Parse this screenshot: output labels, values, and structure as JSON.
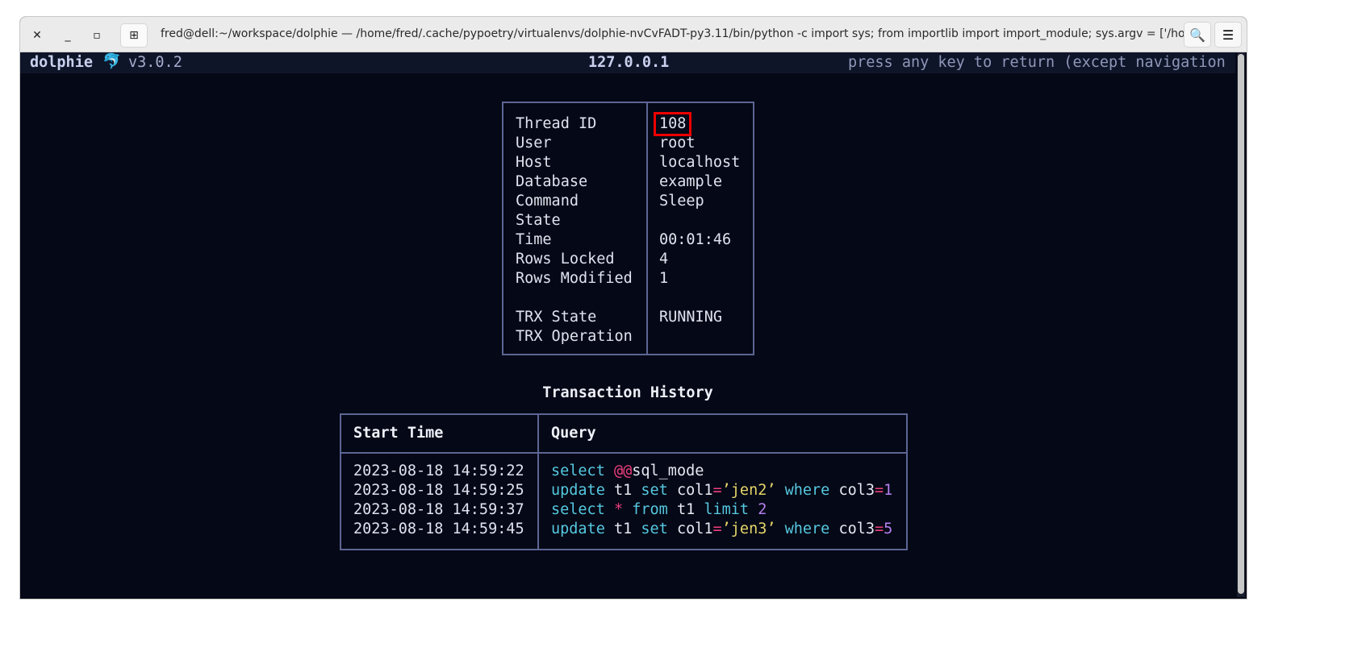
{
  "window": {
    "title": "fred@dell:~/workspace/dolphie — /home/fred/.cache/pypoetry/virtualenvs/dolphie-nvCvFADT-py3.11/bin/python -c import sys; from importlib import import_module; sys.argv = ['/home/fred/.cach…",
    "close": "✕",
    "minimize": "_",
    "maximize": "▫",
    "new_tab": "⊞",
    "search": "🔍",
    "menu": "☰"
  },
  "header": {
    "app": "dolphie",
    "logo": "🐬",
    "version": "v3.0.2",
    "host": "127.0.0.1",
    "hint": "press any key to return (except navigation"
  },
  "info": [
    {
      "label": "Thread ID",
      "value": "108",
      "highlight": true
    },
    {
      "label": "User",
      "value": "root"
    },
    {
      "label": "Host",
      "value": "localhost"
    },
    {
      "label": "Database",
      "value": "example"
    },
    {
      "label": "Command",
      "value": "Sleep"
    },
    {
      "label": "State",
      "value": ""
    },
    {
      "label": "Time",
      "value": "00:01:46"
    },
    {
      "label": "Rows Locked",
      "value": "4"
    },
    {
      "label": "Rows Modified",
      "value": "1"
    },
    {
      "label": "TRX State",
      "value": "RUNNING"
    },
    {
      "label": "TRX Operation",
      "value": ""
    }
  ],
  "history": {
    "title": "Transaction History",
    "columns": [
      "Start Time",
      "Query"
    ],
    "rows": [
      {
        "time": "2023-08-18 14:59:22",
        "query": [
          [
            "k",
            "select"
          ],
          [
            "t",
            " "
          ],
          [
            "v",
            "@@"
          ],
          [
            "t",
            "sql_mode"
          ]
        ]
      },
      {
        "time": "2023-08-18 14:59:25",
        "query": [
          [
            "k",
            "update"
          ],
          [
            "t",
            " t1 "
          ],
          [
            "k",
            "set"
          ],
          [
            "t",
            " col1"
          ],
          [
            "v",
            "="
          ],
          [
            "s",
            "’jen2’"
          ],
          [
            "t",
            " "
          ],
          [
            "k",
            "where"
          ],
          [
            "t",
            " col3"
          ],
          [
            "v",
            "="
          ],
          [
            "n",
            "1"
          ]
        ]
      },
      {
        "time": "2023-08-18 14:59:37",
        "query": [
          [
            "k",
            "select"
          ],
          [
            "t",
            " "
          ],
          [
            "v",
            "*"
          ],
          [
            "t",
            " "
          ],
          [
            "k",
            "from"
          ],
          [
            "t",
            " t1 "
          ],
          [
            "k",
            "limit"
          ],
          [
            "t",
            " "
          ],
          [
            "n",
            "2"
          ]
        ]
      },
      {
        "time": "2023-08-18 14:59:45",
        "query": [
          [
            "k",
            "update"
          ],
          [
            "t",
            " t1 "
          ],
          [
            "k",
            "set"
          ],
          [
            "t",
            " col1"
          ],
          [
            "v",
            "="
          ],
          [
            "s",
            "’jen3’"
          ],
          [
            "t",
            " "
          ],
          [
            "k",
            "where"
          ],
          [
            "t",
            " col3"
          ],
          [
            "v",
            "="
          ],
          [
            "n",
            "5"
          ]
        ]
      }
    ]
  }
}
